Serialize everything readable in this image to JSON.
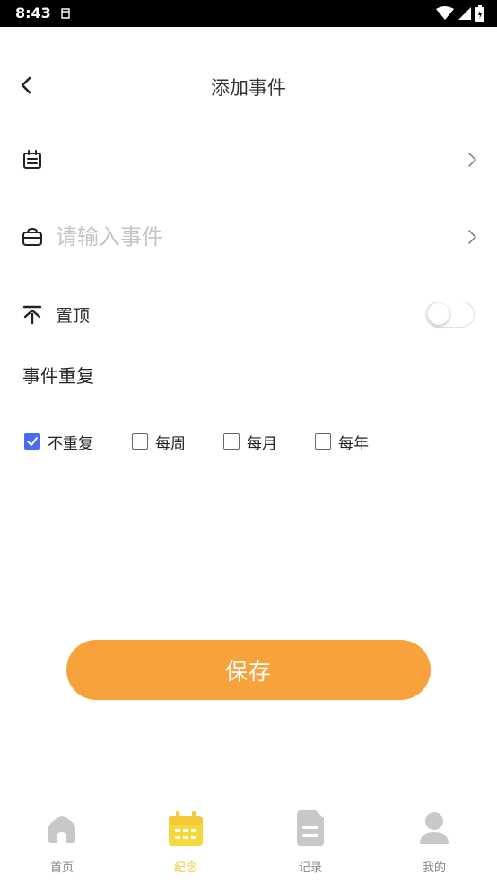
{
  "status_bar": {
    "time": "8:43"
  },
  "header": {
    "title": "添加事件"
  },
  "form": {
    "date_value": "",
    "event_placeholder": "请输入事件",
    "event_value": "",
    "pin_label": "置顶",
    "pin_enabled": false,
    "repeat_title": "事件重复",
    "repeat_options": [
      {
        "label": "不重复",
        "checked": true
      },
      {
        "label": "每周",
        "checked": false
      },
      {
        "label": "每月",
        "checked": false
      },
      {
        "label": "每年",
        "checked": false
      }
    ]
  },
  "save_label": "保存",
  "bottom_nav": {
    "items": [
      {
        "label": "首页",
        "icon": "home-icon",
        "active": false
      },
      {
        "label": "纪念",
        "icon": "calendar-icon",
        "active": true
      },
      {
        "label": "记录",
        "icon": "document-icon",
        "active": false
      },
      {
        "label": "我的",
        "icon": "user-icon",
        "active": false
      }
    ]
  },
  "colors": {
    "accent": "#f8a23c",
    "nav_active": "#f5c83a",
    "nav_inactive": "#c8c8c8",
    "checkbox_checked": "#4a6cf0"
  }
}
